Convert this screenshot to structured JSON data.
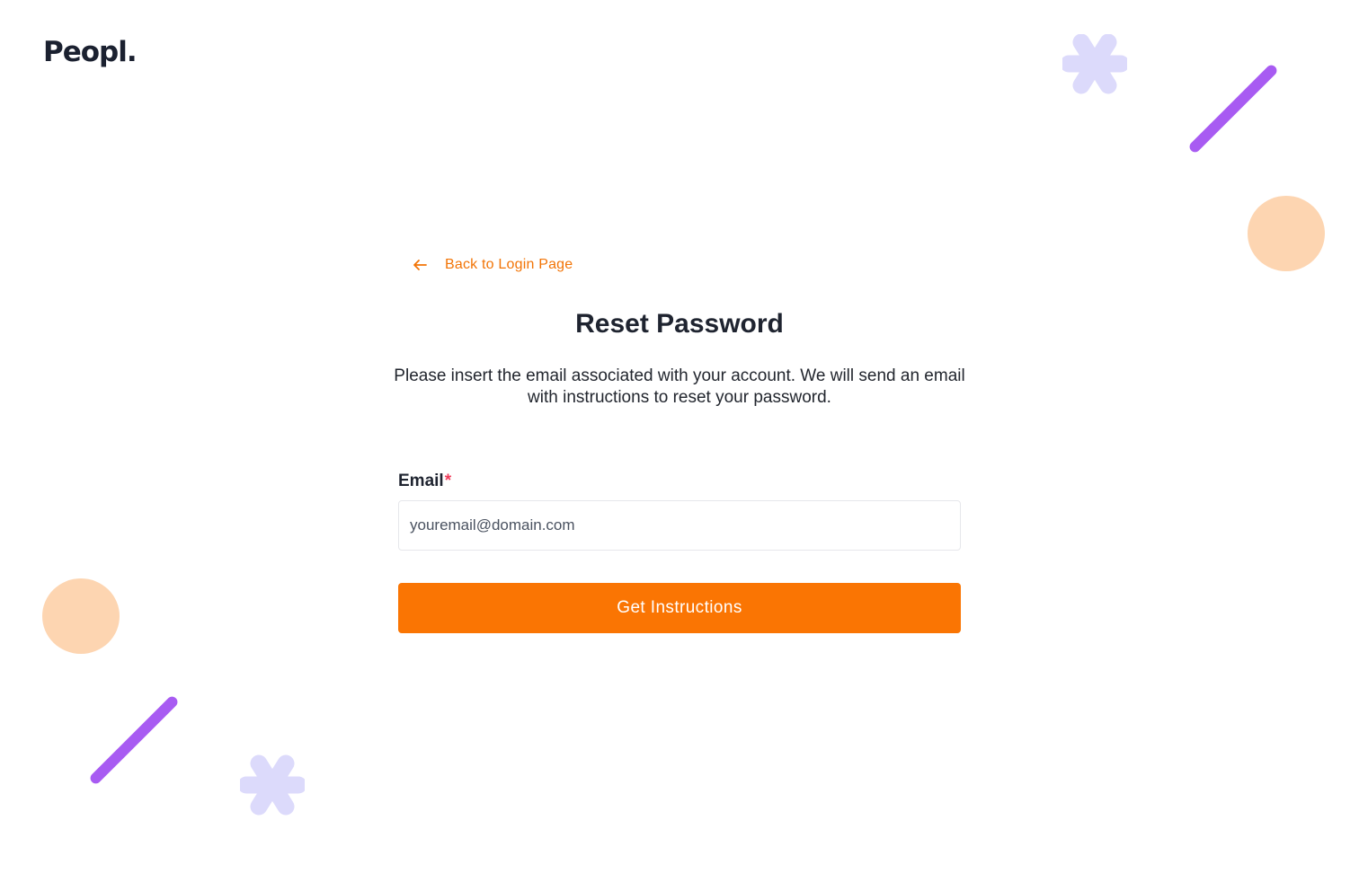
{
  "brand": {
    "logo_text": "Peopl."
  },
  "nav": {
    "back_label": "Back to Login Page",
    "back_icon": "arrow-left-icon"
  },
  "reset": {
    "title": "Reset Password",
    "description": "Please insert the email associated with your account. We will send an email with instructions to reset your password.",
    "email_label": "Email",
    "required_marker": "*",
    "email_value": "",
    "email_placeholder": "youremail@domain.com",
    "submit_label": "Get Instructions"
  },
  "colors": {
    "accent": "#fa7503",
    "link": "#f27406",
    "required": "#ef3c5a",
    "deco_purple": "#a85bf2",
    "deco_lavender": "#dcdafb",
    "deco_peach": "#fdd5b1"
  }
}
